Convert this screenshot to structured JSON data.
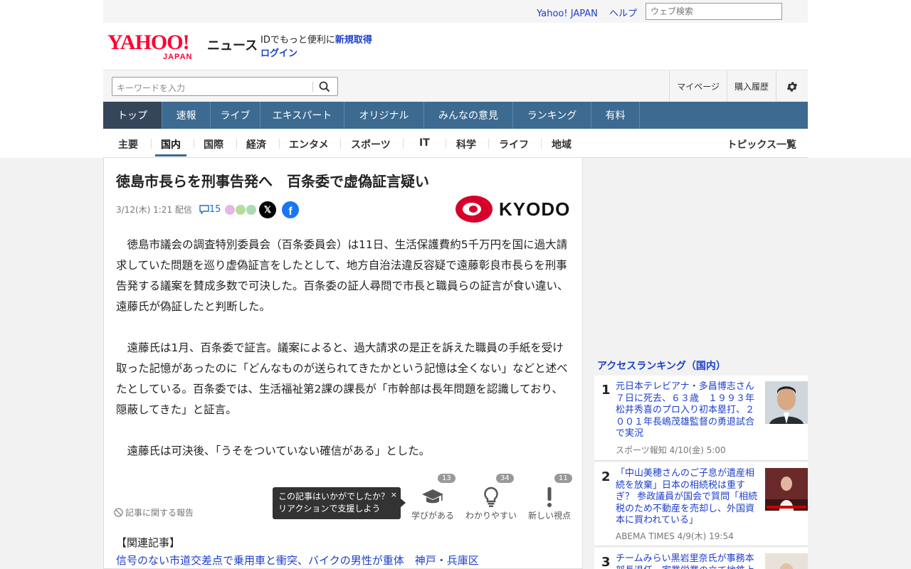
{
  "utility": {
    "yahoo_japan": "Yahoo! JAPAN",
    "help": "ヘルプ",
    "web_search_placeholder": "ウェブ検索"
  },
  "logo": {
    "brand": "YAHOO!",
    "brand_sub": "JAPAN",
    "section": "ニュース"
  },
  "account": {
    "prompt": "IDでもっと便利に",
    "signup": "新規取得",
    "login": "ログイン"
  },
  "search": {
    "placeholder": "キーワードを入力",
    "mypage": "マイページ",
    "purchase_history": "購入履歴"
  },
  "main_nav": [
    "トップ",
    "速報",
    "ライブ",
    "エキスパート",
    "オリジナル",
    "みんなの意見",
    "ランキング",
    "有料"
  ],
  "sub_nav": [
    "主要",
    "国内",
    "国際",
    "経済",
    "エンタメ",
    "スポーツ",
    "IT",
    "科学",
    "ライフ",
    "地域"
  ],
  "topics_all": "トピックス一覧",
  "article": {
    "title": "徳島市長らを刑事告発へ　百条委で虚偽証言疑い",
    "date": "3/12(木) 1:21 配信",
    "comment_count": "15",
    "source": "KYODO",
    "paragraphs": [
      "　徳島市議会の調査特別委員会（百条委員会）は11日、生活保護費約5千万円を国に過大請求していた問題を巡り虚偽証言をしたとして、地方自治法違反容疑で遠藤彰良市長らを刑事告発する議案を賛成多数で可決した。百条委の証人尋問で市長と職員らの証言が食い違い、遠藤氏が偽証したと判断した。",
      "　遠藤氏は1月、百条委で証言。議案によると、過大請求の是正を訴えた職員の手紙を受け取った記憶があったのに「どんなものが送られてきたかという記憶は全くない」などと述べたとしている。百条委では、生活福祉第2課の課長が「市幹部は長年問題を認識しており、隠蔽してきた」と証言。",
      "　遠藤氏は可決後、「うそをついていない確信がある」とした。"
    ],
    "report": "記事に関する報告",
    "tooltip": {
      "line1": "この記事はいかがでしたか？",
      "line2": "リアクションで支援しよう",
      "close": "×"
    },
    "reactions": [
      {
        "label": "学びがある",
        "count": "13",
        "icon": "graduation-cap-icon"
      },
      {
        "label": "わかりやすい",
        "count": "34",
        "icon": "lightbulb-icon"
      },
      {
        "label": "新しい視点",
        "count": "11",
        "icon": "exclamation-icon"
      }
    ],
    "related_heading": "【関連記事】",
    "related_link": "信号のない市道交差点で乗用車と衝突、バイクの男性が重体　神戸・兵庫区"
  },
  "ranking": {
    "heading": "アクセスランキング（国内）",
    "items": [
      {
        "rank": "1",
        "title": "元日本テレビアナ・多昌博志さん７日に死去、６３歳　１９９３年松井秀喜のプロ入り初本塁打、２００１年長嶋茂雄監督の勇退試合で実況",
        "source": "スポーツ報知 4/10(金) 5:00"
      },
      {
        "rank": "2",
        "title": "「中山美穂さんのご子息が遺産相続を放棄」日本の相続税は重すぎ？ 参政議員が国会で質問「相続税のため不動産を売却し、外国資本に買われている」",
        "source": "ABEMA TIMES 4/9(木) 19:54"
      },
      {
        "rank": "3",
        "title": "チームみらい黒岩里奈氏が事務本部長退任　家業労業の立て地鉄上",
        "source": ""
      }
    ]
  },
  "colors": {
    "brand_red": "#ff0033",
    "nav_blue": "#3d6a90",
    "nav_active": "#36465a",
    "link_blue": "#1d40c8"
  }
}
